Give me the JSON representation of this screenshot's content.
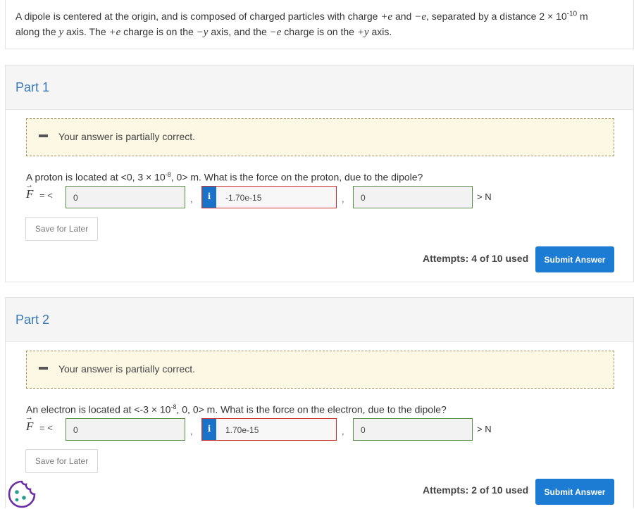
{
  "problem": {
    "text_1": "A dipole is centered at the origin, and is composed of charged particles with charge ",
    "plus_e": "+e",
    "and": " and ",
    "minus_e": "−e",
    "text_2": ", separated by a distance 2 × 10",
    "exp": "-10",
    "text_3": " m",
    "line2_a": "along the ",
    "y1": "y",
    "line2_b": " axis. The ",
    "plus_e2": "+e",
    "line2_c": " charge is on the ",
    "neg_y": "−y",
    "line2_d": " axis, and the ",
    "minus_e2": "−e",
    "line2_e": " charge is on the ",
    "pos_y": "+y",
    "line2_f": " axis."
  },
  "parts": [
    {
      "title": "Part 1",
      "feedback": "Your answer is partially correct.",
      "question_a": "A proton is located at <0, 3 × 10",
      "question_exp": "-8",
      "question_b": ", 0> m. What is the force on the proton, due to the dipole?",
      "vector_symbol": "F",
      "eq_open": "= <",
      "x_value": "0",
      "y_value": "-1.70e-15",
      "z_value": "0",
      "unit": "> N",
      "save_label": "Save for Later",
      "attempts": "Attempts: 4 of 10 used",
      "submit_label": "Submit Answer"
    },
    {
      "title": "Part 2",
      "feedback": "Your answer is partially correct.",
      "question_a": "An electron is located at <-3 × 10",
      "question_exp": "-8",
      "question_b": ", 0, 0> m. What is the force on the electron, due to the dipole?",
      "vector_symbol": "F",
      "eq_open": "= <",
      "x_value": "0",
      "y_value": "1.70e-15",
      "z_value": "0",
      "unit": "> N",
      "save_label": "Save for Later",
      "attempts": "Attempts: 2 of 10 used",
      "submit_label": "Submit Answer"
    }
  ],
  "comma": ",",
  "info_glyph": "i",
  "icons": {
    "info": "info-icon",
    "cookie": "cookie-icon",
    "partial": "partial-correct-icon"
  },
  "colors": {
    "accent": "#1c7bd2",
    "correct_border": "#5c8e4a",
    "wrong_border": "#c9302c",
    "feedback_bg": "#fcf8e3"
  }
}
